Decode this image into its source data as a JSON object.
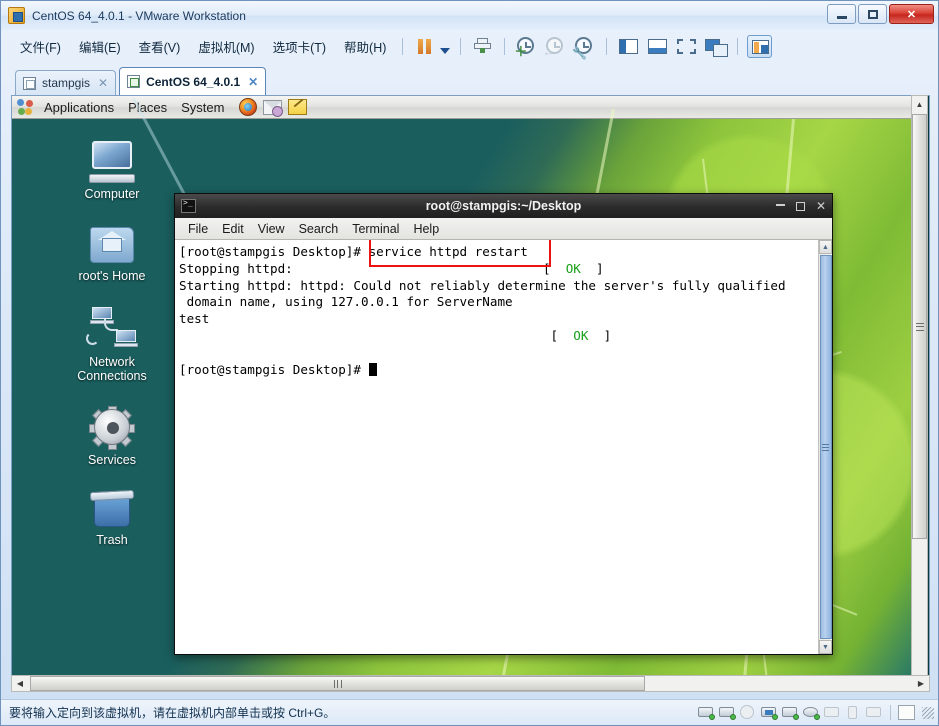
{
  "window": {
    "title": "CentOS 64_4.0.1 - VMware Workstation",
    "app_icon": "vmware-icon",
    "caption": {
      "minimize": "minimize-button",
      "maximize": "maximize-button",
      "close": "✕"
    }
  },
  "menubar": {
    "items": [
      {
        "label": "文件(F)"
      },
      {
        "label": "编辑(E)"
      },
      {
        "label": "查看(V)"
      },
      {
        "label": "虚拟机(M)"
      },
      {
        "label": "选项卡(T)"
      },
      {
        "label": "帮助(H)"
      }
    ],
    "toolbar": [
      {
        "name": "pause-vm-button"
      },
      {
        "name": "pause-dropdown-button"
      },
      {
        "name": "send-ctrl-alt-del-button"
      },
      {
        "name": "take-snapshot-button"
      },
      {
        "name": "revert-snapshot-button"
      },
      {
        "name": "manage-snapshots-button"
      },
      {
        "name": "show-library-panel-button"
      },
      {
        "name": "show-console-view-button"
      },
      {
        "name": "enter-fullscreen-button"
      },
      {
        "name": "multiple-monitors-button"
      },
      {
        "name": "show-thumbnails-button"
      }
    ]
  },
  "tabs": [
    {
      "label": "stampgis",
      "active": false,
      "close": "✕"
    },
    {
      "label": "CentOS 64_4.0.1",
      "active": true,
      "close": "✕"
    }
  ],
  "gnome_panel": {
    "applications": "Applications",
    "places": "Places",
    "system": "System",
    "launchers": [
      "firefox-icon",
      "evolution-mail-icon",
      "text-editor-icon"
    ]
  },
  "desktop": {
    "icons": [
      {
        "label": "Computer",
        "icon": "computer-icon"
      },
      {
        "label": "root's Home",
        "icon": "home-folder-icon"
      },
      {
        "label": "Network Connections",
        "icon": "network-connections-icon"
      },
      {
        "label": "Services",
        "icon": "services-gear-icon"
      },
      {
        "label": "Trash",
        "icon": "trash-icon"
      }
    ]
  },
  "terminal": {
    "title": "root@stampgis:~/Desktop",
    "menu": [
      "File",
      "Edit",
      "View",
      "Search",
      "Terminal",
      "Help"
    ],
    "prompt": "[root@stampgis Desktop]# ",
    "command": "service httpd restart",
    "lines": [
      {
        "text": "Stopping httpd:",
        "status": "OK"
      },
      {
        "text": "Starting httpd: httpd: Could not reliably determine the server's fully qualified"
      },
      {
        "text": " domain name, using 127.0.0.1 for ServerName"
      },
      {
        "text": "test"
      },
      {
        "text": "",
        "status": "OK"
      }
    ],
    "status_ok": "OK",
    "final_prompt": "[root@stampgis Desktop]# ",
    "annotation_color": "#ee1111"
  },
  "statusbar": {
    "message": "要将输入定向到该虚拟机，请在虚拟机内部单击或按 Ctrl+G。",
    "devices": [
      "hard-disk-1-icon",
      "hard-disk-2-icon",
      "cd-dvd-icon",
      "network-adapter-icon",
      "printer-icon",
      "sound-card-icon",
      "display-icon",
      "usb-icon",
      "camera-icon"
    ]
  },
  "colors": {
    "accent": "#2f6fae",
    "ok_green": "#18a018",
    "annotation_red": "#ee1111",
    "desktop_teal": "#1a5e5e"
  }
}
